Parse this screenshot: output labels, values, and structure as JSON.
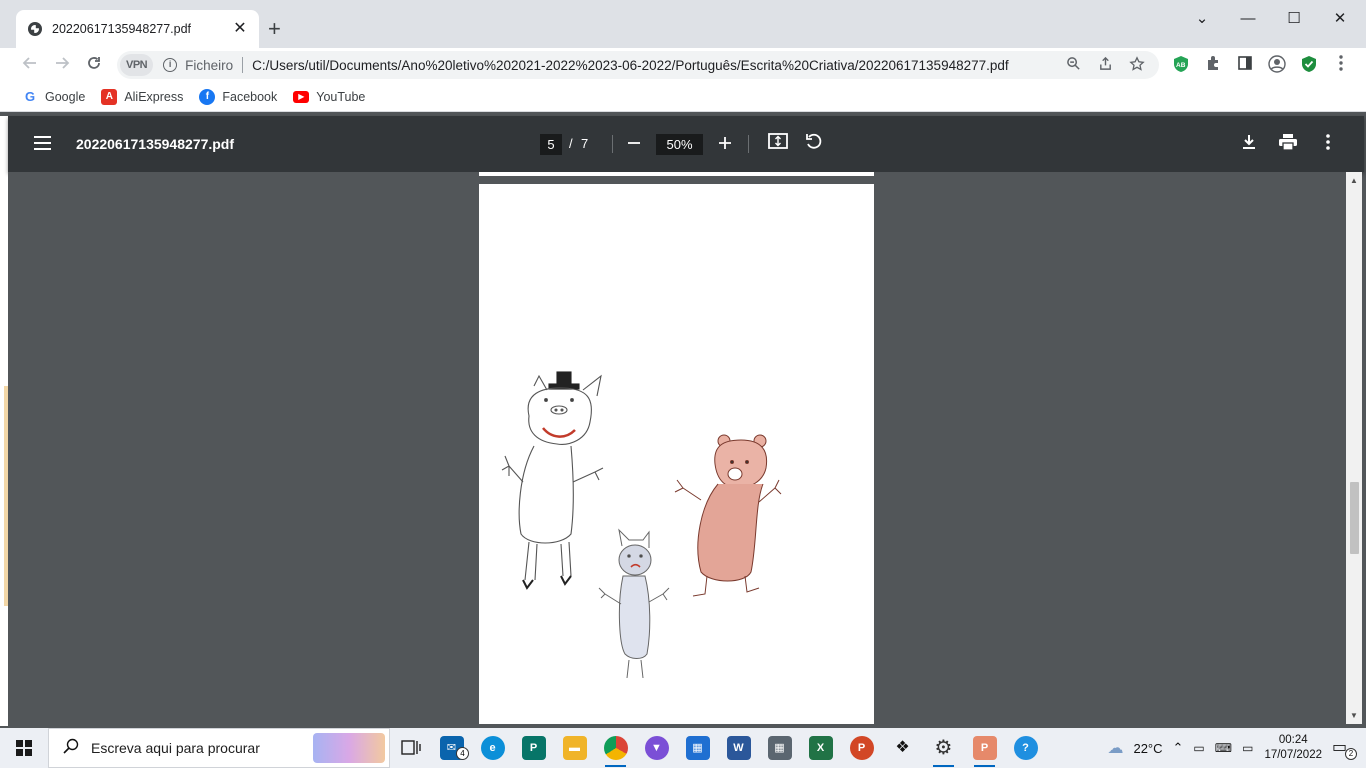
{
  "browser": {
    "tab_title": "20220617135948277.pdf",
    "tab_close": "✕",
    "new_tab": "+",
    "window_controls": {
      "menu": "⌄",
      "minimize": "—",
      "maximize": "☐",
      "close": "✕"
    }
  },
  "omnibox": {
    "vpn_label": "VPN",
    "scheme_label": "Ficheiro",
    "url": "C:/Users/util/Documents/Ano%20letivo%202021-2022%2023-06-2022/Português/Escrita%20Criativa/20220617135948277.pdf"
  },
  "bookmarks": [
    {
      "label": "Google",
      "icon": "google-icon",
      "color": "#4285f4",
      "glyph": "G"
    },
    {
      "label": "AliExpress",
      "icon": "aliexpress-icon",
      "color": "#e43225",
      "glyph": "A"
    },
    {
      "label": "Facebook",
      "icon": "facebook-icon",
      "color": "#1877f2",
      "glyph": "f"
    },
    {
      "label": "YouTube",
      "icon": "youtube-icon",
      "color": "#ff0000",
      "glyph": "▶"
    }
  ],
  "pdf": {
    "file_name": "20220617135948277.pdf",
    "current_page": "5",
    "page_separator": "/",
    "total_pages": "7",
    "zoom": "50%"
  },
  "taskbar": {
    "search_placeholder": "Escreva aqui para procurar",
    "mail_badge": "4",
    "weather": "22°C",
    "time": "00:24",
    "date": "17/07/2022",
    "notification_count": "2"
  },
  "colors": {
    "pdf_toolbar": "#323639",
    "viewer_bg": "#525659",
    "taskbar": "#eceff4",
    "accent": "#0067c0"
  }
}
